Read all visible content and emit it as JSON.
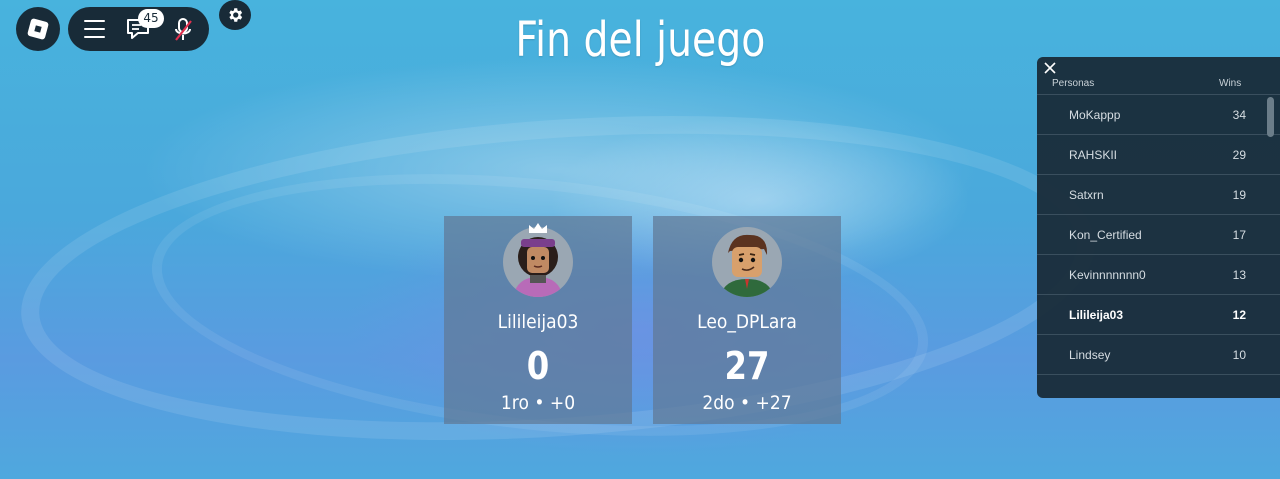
{
  "topbar": {
    "chat_badge": "45",
    "icons": [
      "roblox-logo-icon",
      "menu-icon",
      "chat-icon",
      "mic-muted-icon",
      "gear-icon"
    ]
  },
  "title": "Fin del juego",
  "players": [
    {
      "name": "Lilileija03",
      "score": "0",
      "rank": "1ro • +0",
      "has_crown": true
    },
    {
      "name": "Leo_DPLara",
      "score": "27",
      "rank": "2do • +27",
      "has_crown": false
    }
  ],
  "leaderboard": {
    "col_people": "Personas",
    "col_wins": "Wins",
    "rows": [
      {
        "name": "MoKappp",
        "wins": "34"
      },
      {
        "name": "RAHSKII",
        "wins": "29"
      },
      {
        "name": "Satxrn",
        "wins": "19"
      },
      {
        "name": "Kon_Certified",
        "wins": "17"
      },
      {
        "name": "Kevinnnnnnn0",
        "wins": "13"
      },
      {
        "name": "Lilileija03",
        "wins": "12"
      },
      {
        "name": "Lindsey",
        "wins": "10"
      }
    ],
    "self_name": "Lilileija03"
  },
  "colors": {
    "panel": "#182b38",
    "background": "#48b3dd"
  }
}
